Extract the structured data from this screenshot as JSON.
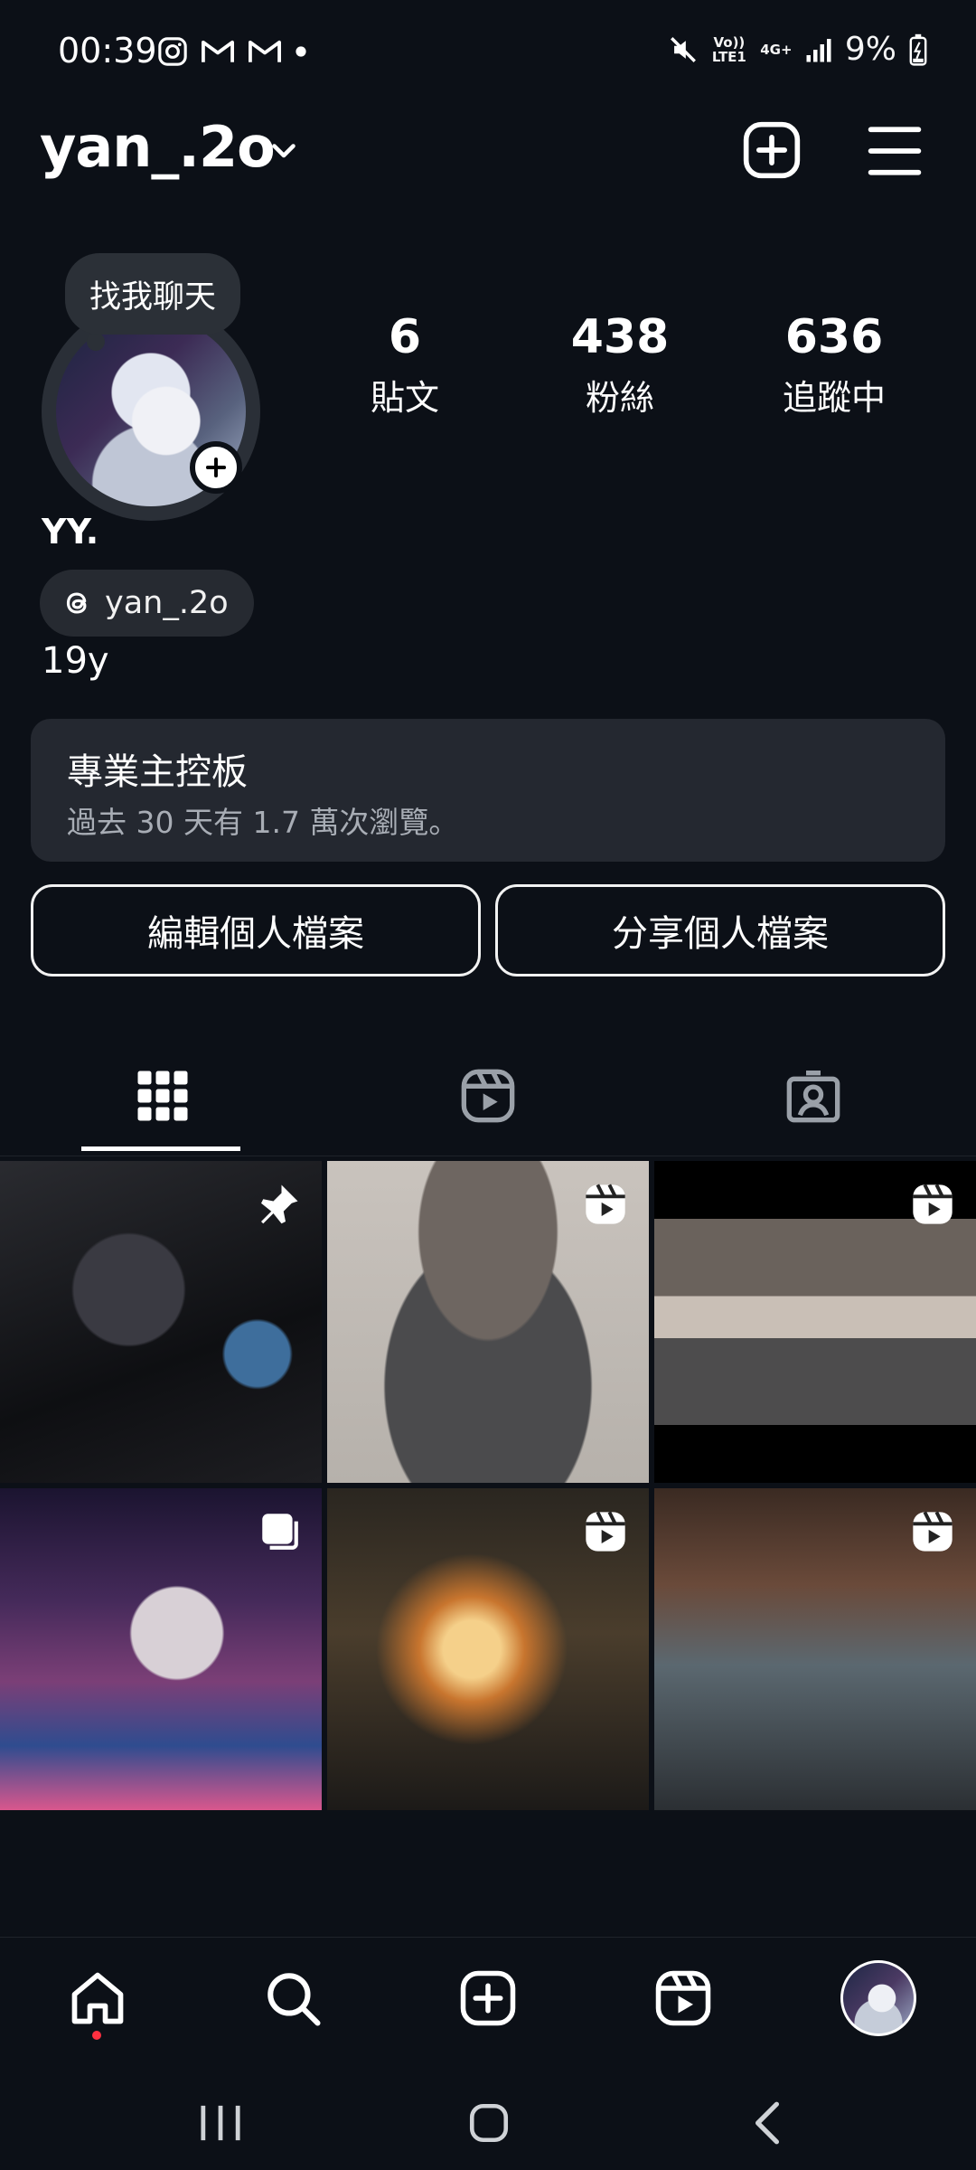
{
  "status_bar": {
    "time": "00:39",
    "lte_label": "Vo)) LTE1",
    "network": "4G+",
    "battery": "9%"
  },
  "header": {
    "username": "yan_.2o"
  },
  "profile": {
    "note": "找我聊天",
    "stats": [
      {
        "value": "6",
        "label": "貼文"
      },
      {
        "value": "438",
        "label": "粉絲"
      },
      {
        "value": "636",
        "label": "追蹤中"
      }
    ],
    "display_name": "YY.",
    "threads_handle": "yan_.2o",
    "bio": "19y"
  },
  "dashboard": {
    "title": "專業主控板",
    "subtitle": "過去 30 天有 1.7 萬次瀏覽。"
  },
  "buttons": {
    "edit": "編輯個人檔案",
    "share": "分享個人檔案"
  },
  "tabs": [
    "grid-icon",
    "reels-icon",
    "tagged-icon"
  ],
  "grid": [
    {
      "type": "pinned"
    },
    {
      "type": "reel"
    },
    {
      "type": "reel"
    },
    {
      "type": "carousel"
    },
    {
      "type": "reel"
    },
    {
      "type": "reel"
    }
  ],
  "colors": {
    "background": "#0c1017",
    "card": "#242830",
    "notification_dot": "#ff3040"
  }
}
